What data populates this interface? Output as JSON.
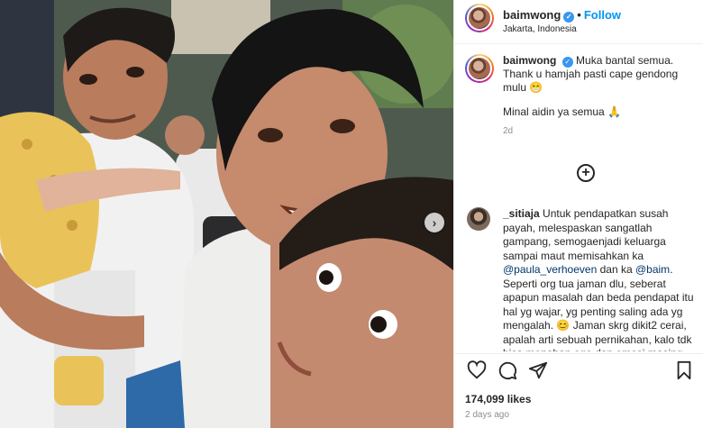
{
  "post": {
    "carousel_next_glyph": "›"
  },
  "header": {
    "username": "baimwong",
    "verified_glyph": "✓",
    "separator": "•",
    "follow_label": "Follow",
    "location": "Jakarta, Indonesia"
  },
  "caption": {
    "username": "baimwong",
    "line1": "Muka bantal semua.",
    "line2": "Thank u hamjah pasti cape gendong mulu",
    "emoji1": "😁",
    "line3": "Minal aidin ya semua",
    "emoji2": "🙏",
    "time": "2d"
  },
  "load_more_glyph": "+",
  "comment": {
    "username": "_sitiaja",
    "text_part1": "Untuk pendapatkan susah payah, melespaskan sangatlah gampang, semogaenjadi keluarga sampai maut memisahkan ka",
    "mention1": "@paula_verhoeven",
    "text_part2": "dan ka",
    "mention2": "@baim",
    "text_part3": ". Seperti org tua jaman dlu, seberat apapun masalah dan beda pendapat itu hal yg wajar, yg penting saling ada yg mengalah.",
    "emoji": "😊",
    "text_part4": "Jaman skrg dikit2 cerai, apalah arti sebuah pernikahan, kalo tdk bisa menahan ego dan emosi masing masing"
  },
  "actions": {
    "like_icon": "heart-icon",
    "comment_icon": "comment-icon",
    "share_icon": "share-icon",
    "save_icon": "bookmark-icon"
  },
  "likes": "174,099 likes",
  "posted_ago": "2 days ago"
}
